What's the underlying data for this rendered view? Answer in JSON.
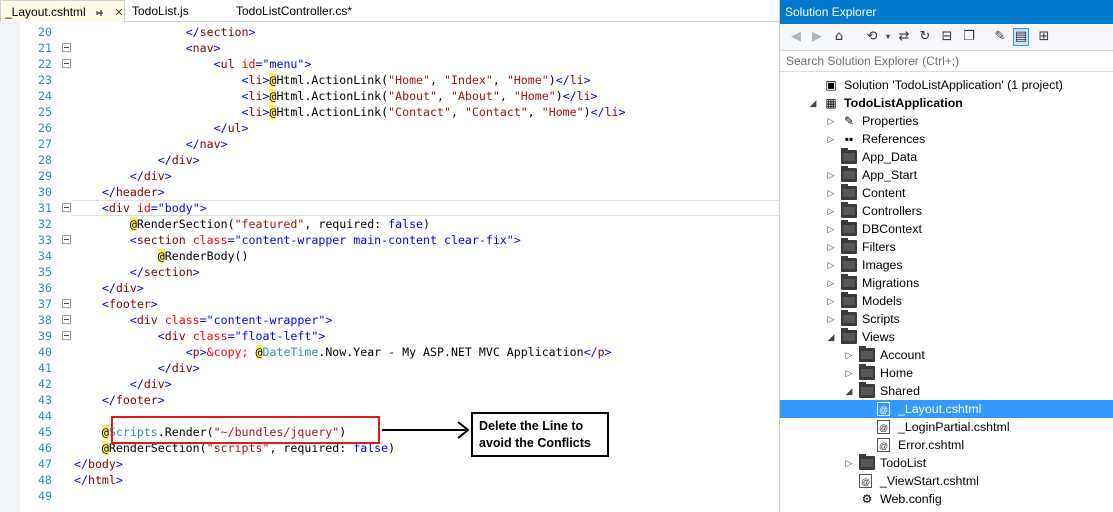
{
  "tabs": [
    {
      "label": "_Layout.cshtml",
      "active": true
    },
    {
      "label": "TodoList.js"
    },
    {
      "label": "TodoListController.cs*"
    }
  ],
  "code_lines": [
    {
      "n": "20",
      "html": "                </section>"
    },
    {
      "n": "21",
      "html": "                <nav>"
    },
    {
      "n": "22",
      "html": "                    <ul id=\"menu\">"
    },
    {
      "n": "23",
      "html": "                        <li>@Html.ActionLink(\"Home\", \"Index\", \"Home\")</li>"
    },
    {
      "n": "24",
      "html": "                        <li>@Html.ActionLink(\"About\", \"About\", \"Home\")</li>"
    },
    {
      "n": "25",
      "html": "                        <li>@Html.ActionLink(\"Contact\", \"Contact\", \"Home\")</li>"
    },
    {
      "n": "26",
      "html": "                    </ul>"
    },
    {
      "n": "27",
      "html": "                </nav>"
    },
    {
      "n": "28",
      "html": "            </div>"
    },
    {
      "n": "29",
      "html": "        </div>"
    },
    {
      "n": "30",
      "html": "    </header>"
    },
    {
      "n": "31",
      "html": "    <div id=\"body\">"
    },
    {
      "n": "32",
      "html": "        @RenderSection(\"featured\", required: false)"
    },
    {
      "n": "33",
      "html": "        <section class=\"content-wrapper main-content clear-fix\">"
    },
    {
      "n": "34",
      "html": "            @RenderBody()"
    },
    {
      "n": "35",
      "html": "        </section>"
    },
    {
      "n": "36",
      "html": "    </div>"
    },
    {
      "n": "37",
      "html": "    <footer>"
    },
    {
      "n": "38",
      "html": "        <div class=\"content-wrapper\">"
    },
    {
      "n": "39",
      "html": "            <div class=\"float-left\">"
    },
    {
      "n": "40",
      "html": "                <p>&copy; @DateTime.Now.Year - My ASP.NET MVC Application</p>"
    },
    {
      "n": "41",
      "html": "            </div>"
    },
    {
      "n": "42",
      "html": "        </div>"
    },
    {
      "n": "43",
      "html": "    </footer>"
    },
    {
      "n": "44",
      "html": ""
    },
    {
      "n": "45",
      "html": "    @Scripts.Render(\"~/bundles/jquery\")"
    },
    {
      "n": "46",
      "html": "    @RenderSection(\"scripts\", required: false)"
    },
    {
      "n": "47",
      "html": "</body>"
    },
    {
      "n": "48",
      "html": "</html>"
    },
    {
      "n": "49",
      "html": ""
    }
  ],
  "annotation": {
    "callout_line1": "Delete the Line to",
    "callout_line2": "avoid the Conflicts"
  },
  "solution_explorer": {
    "title": "Solution Explorer",
    "search_placeholder": "Search Solution Explorer (Ctrl+;)",
    "toolbar_icons": [
      "back-icon",
      "forward-icon",
      "home-icon",
      "history-icon",
      "dropdown-icon",
      "sync-icon",
      "refresh-icon",
      "collapse-all-icon",
      "copy-icon",
      "properties-icon",
      "show-all-files-icon",
      "view-class-diagram-icon"
    ],
    "tree": [
      {
        "label": "Solution 'TodoListApplication' (1 project)",
        "kind": "solution",
        "depth": 0,
        "exp": ""
      },
      {
        "label": "TodoListApplication",
        "kind": "project",
        "depth": 0,
        "exp": "open",
        "bold": true
      },
      {
        "label": "Properties",
        "kind": "wrench",
        "depth": 1,
        "exp": "closed"
      },
      {
        "label": "References",
        "kind": "refs",
        "depth": 1,
        "exp": "closed"
      },
      {
        "label": "App_Data",
        "kind": "folder",
        "depth": 1,
        "exp": ""
      },
      {
        "label": "App_Start",
        "kind": "folder",
        "depth": 1,
        "exp": "closed"
      },
      {
        "label": "Content",
        "kind": "folder",
        "depth": 1,
        "exp": "closed"
      },
      {
        "label": "Controllers",
        "kind": "folder",
        "depth": 1,
        "exp": "closed"
      },
      {
        "label": "DBContext",
        "kind": "folder",
        "depth": 1,
        "exp": "closed"
      },
      {
        "label": "Filters",
        "kind": "folder",
        "depth": 1,
        "exp": "closed"
      },
      {
        "label": "Images",
        "kind": "folder",
        "depth": 1,
        "exp": "closed"
      },
      {
        "label": "Migrations",
        "kind": "folder",
        "depth": 1,
        "exp": "closed"
      },
      {
        "label": "Models",
        "kind": "folder",
        "depth": 1,
        "exp": "closed"
      },
      {
        "label": "Scripts",
        "kind": "folder",
        "depth": 1,
        "exp": "closed"
      },
      {
        "label": "Views",
        "kind": "folder",
        "depth": 1,
        "exp": "open"
      },
      {
        "label": "Account",
        "kind": "folder",
        "depth": 2,
        "exp": "closed"
      },
      {
        "label": "Home",
        "kind": "folder",
        "depth": 2,
        "exp": "closed"
      },
      {
        "label": "Shared",
        "kind": "folder",
        "depth": 2,
        "exp": "open"
      },
      {
        "label": "_Layout.cshtml",
        "kind": "file",
        "depth": 3,
        "exp": "",
        "selected": true
      },
      {
        "label": "_LoginPartial.cshtml",
        "kind": "file",
        "depth": 3,
        "exp": ""
      },
      {
        "label": "Error.cshtml",
        "kind": "file",
        "depth": 3,
        "exp": ""
      },
      {
        "label": "TodoList",
        "kind": "folder",
        "depth": 2,
        "exp": "closed"
      },
      {
        "label": "_ViewStart.cshtml",
        "kind": "file",
        "depth": 2,
        "exp": ""
      },
      {
        "label": "Web.config",
        "kind": "config",
        "depth": 2,
        "exp": ""
      }
    ]
  },
  "colors": {
    "accent": "#007acc",
    "selection": "#3399ff",
    "annotation_box": "#e01b1b"
  }
}
